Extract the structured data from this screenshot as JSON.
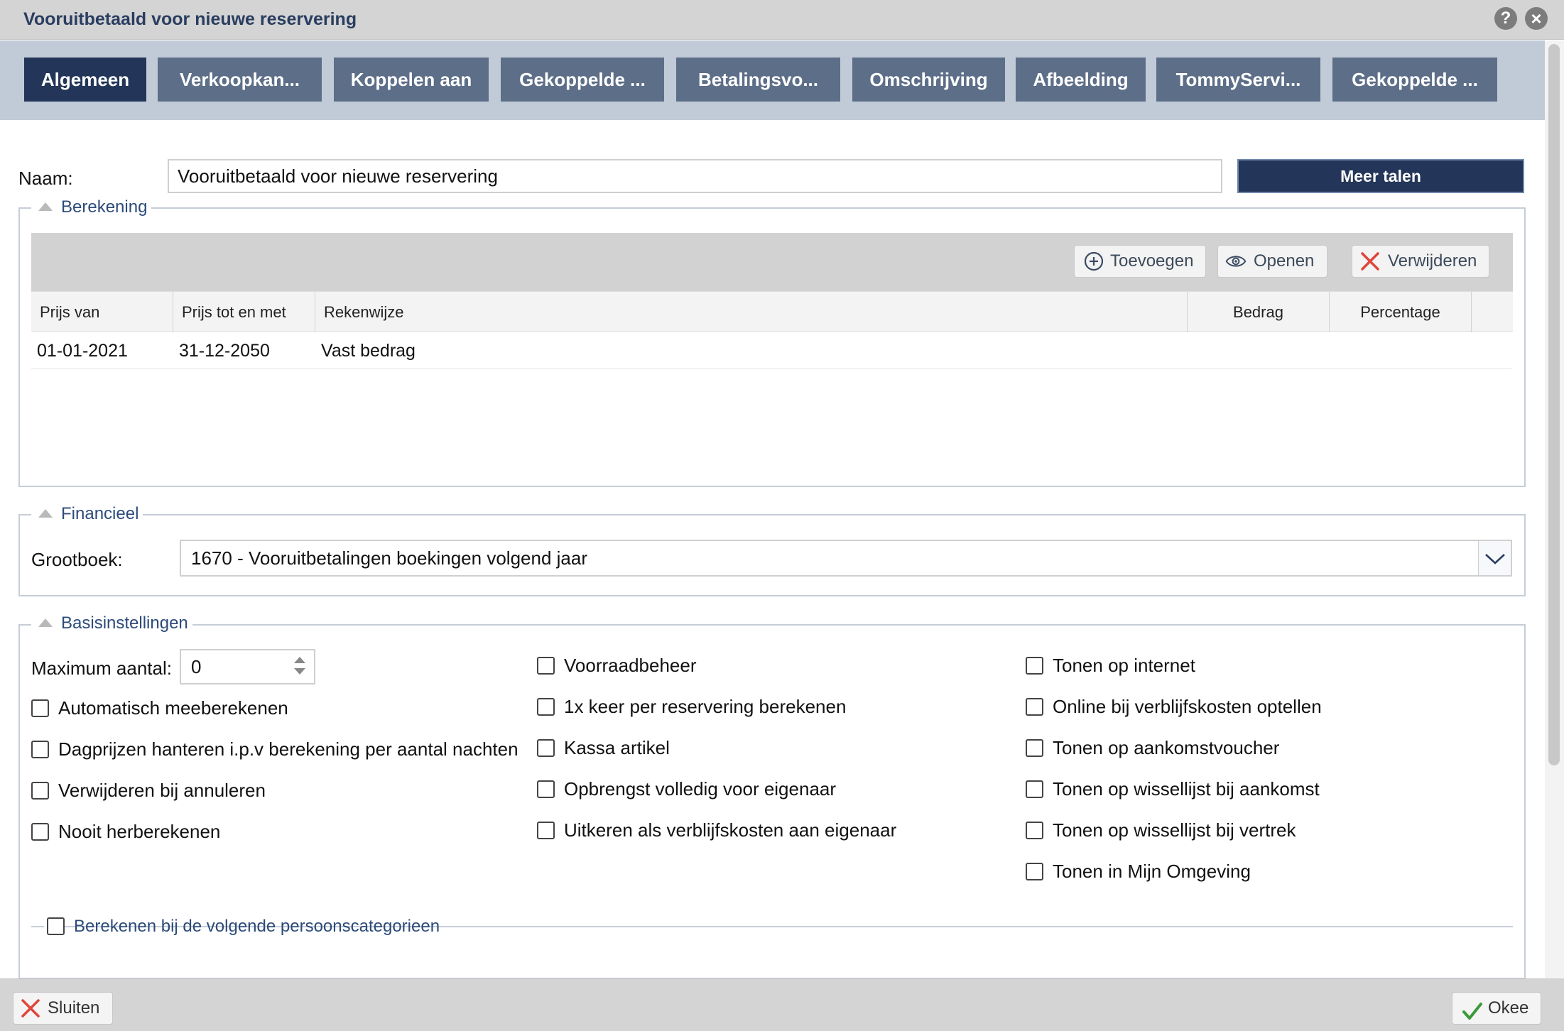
{
  "window": {
    "title": "Vooruitbetaald voor nieuwe reservering"
  },
  "tabs": [
    {
      "label": "Algemeen",
      "active": true
    },
    {
      "label": "Verkoopkan...",
      "active": false
    },
    {
      "label": "Koppelen aan",
      "active": false
    },
    {
      "label": "Gekoppelde ...",
      "active": false
    },
    {
      "label": "Betalingsvo...",
      "active": false
    },
    {
      "label": "Omschrijving",
      "active": false
    },
    {
      "label": "Afbeelding",
      "active": false
    },
    {
      "label": "TommyServi...",
      "active": false
    },
    {
      "label": "Gekoppelde ...",
      "active": false
    }
  ],
  "name": {
    "label": "Naam:",
    "value": "Vooruitbetaald voor nieuwe reservering",
    "more_languages": "Meer talen"
  },
  "berekening": {
    "legend": "Berekening",
    "toolbar": {
      "add": "Toevoegen",
      "open": "Openen",
      "delete": "Verwijderen"
    },
    "columns": [
      "Prijs van",
      "Prijs tot en met",
      "Rekenwijze",
      "Bedrag",
      "Percentage"
    ],
    "rows": [
      {
        "from": "01-01-2021",
        "to": "31-12-2050",
        "method": "Vast bedrag",
        "amount": "",
        "percentage": ""
      }
    ]
  },
  "financieel": {
    "legend": "Financieel",
    "ledger_label": "Grootboek:",
    "ledger_value": "1670 - Vooruitbetalingen boekingen volgend jaar"
  },
  "basis": {
    "legend": "Basisinstellingen",
    "max_label": "Maximum aantal:",
    "max_value": "0",
    "col1": [
      {
        "label": "Automatisch meeberekenen",
        "checked": false
      },
      {
        "label": "Dagprijzen hanteren i.p.v berekening per aantal nachten",
        "checked": false
      },
      {
        "label": "Verwijderen bij annuleren",
        "checked": false
      },
      {
        "label": "Nooit herberekenen",
        "checked": false
      }
    ],
    "col2": [
      {
        "label": "Voorraadbeheer",
        "checked": false
      },
      {
        "label": "1x keer per reservering berekenen",
        "checked": false
      },
      {
        "label": "Kassa artikel",
        "checked": false
      },
      {
        "label": "Opbrengst volledig voor eigenaar",
        "checked": false
      },
      {
        "label": "Uitkeren als verblijfskosten aan eigenaar",
        "checked": false
      }
    ],
    "col3": [
      {
        "label": "Tonen op internet",
        "checked": false
      },
      {
        "label": "Online bij verblijfskosten optellen",
        "checked": false
      },
      {
        "label": "Tonen op aankomstvoucher",
        "checked": false
      },
      {
        "label": "Tonen op wissellijst bij aankomst",
        "checked": false
      },
      {
        "label": "Tonen op wissellijst bij vertrek",
        "checked": false
      },
      {
        "label": "Tonen in Mijn Omgeving",
        "checked": false
      }
    ],
    "categories_label": "Berekenen bij de volgende persoonscategorieen"
  },
  "footer": {
    "close": "Sluiten",
    "ok": "Okee"
  },
  "colors": {
    "accent": "#233659",
    "tab": "#5d6e88",
    "tabbar": "#c1cad7",
    "legend_text": "#2c4a7a",
    "danger": "#e0453a",
    "success": "#3a9a3a"
  }
}
